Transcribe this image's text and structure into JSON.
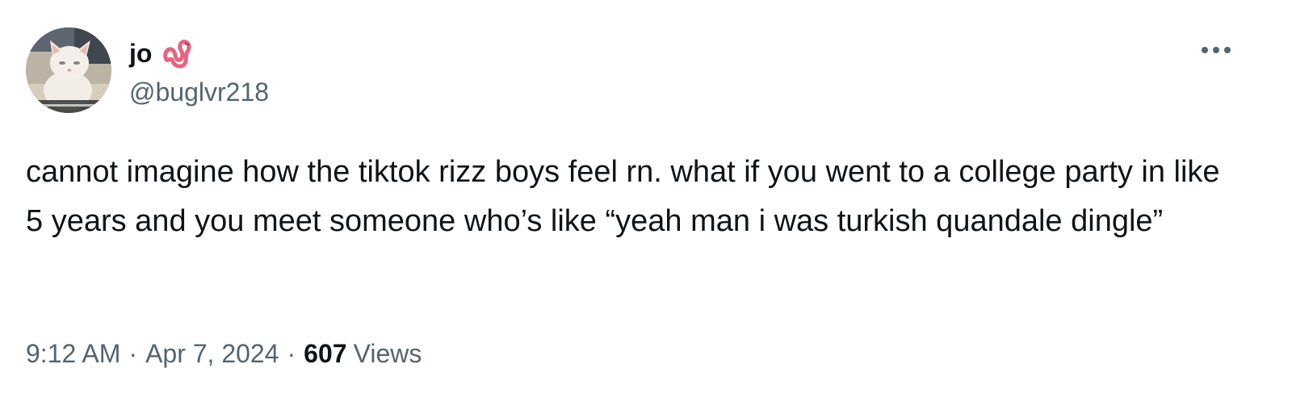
{
  "tweet": {
    "author": {
      "display_name": "jo",
      "name_emoji_icon": "pink-worm-emoji",
      "handle": "@buglvr218",
      "avatar": "cat-avatar"
    },
    "more_icon": "more-horizontal-icon",
    "text": "cannot imagine how the tiktok rizz boys feel rn. what if you went to a college party in like 5 years and you meet someone who’s like “yeah man i was turkish quandale dingle”",
    "time": "9:12 AM",
    "date": "Apr 7, 2024",
    "separator": "·",
    "views_count": "607",
    "views_label": "Views"
  },
  "colors": {
    "text_primary": "#0f1419",
    "text_secondary": "#536471",
    "emoji_pink": "#e8637f",
    "background": "#ffffff"
  }
}
